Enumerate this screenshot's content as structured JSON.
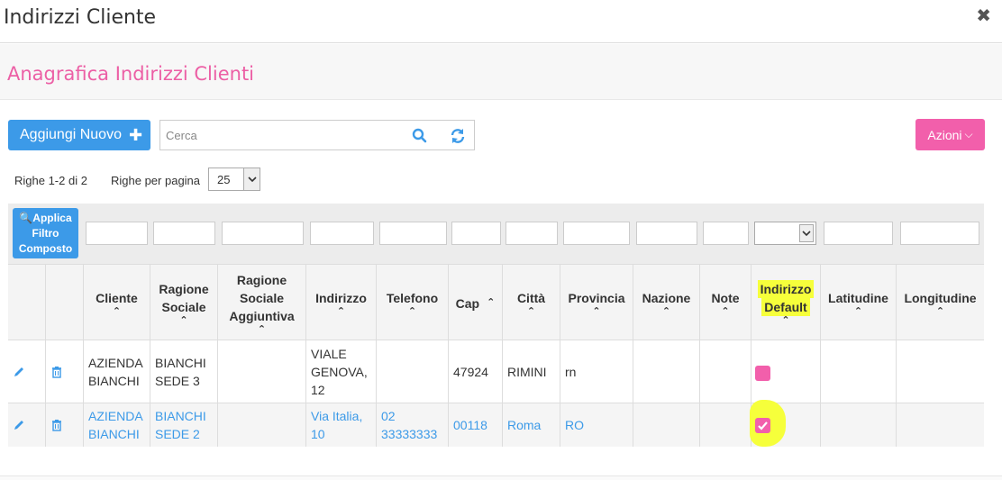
{
  "modal": {
    "title": "Indirizzi Cliente",
    "close_glyph": "✖"
  },
  "section": {
    "title": "Anagrafica Indirizzi Clienti"
  },
  "toolbar": {
    "add_label": "Aggiungi Nuovo",
    "add_glyph": "✚",
    "search_placeholder": "Cerca",
    "actions_label": "Azioni",
    "actions_glyph": "⌵"
  },
  "paging": {
    "rows_info": "Righe 1-2 di 2",
    "rows_per_page_label": "Righe per pagina",
    "rows_per_page_value": "25"
  },
  "filter": {
    "apply_label": "🔍Applica Filtro Composto"
  },
  "columns": [
    "",
    "",
    "Cliente",
    "Ragione Sociale",
    "Ragione Sociale Aggiuntiva",
    "Indirizzo",
    "Telefono",
    "Cap",
    "Città",
    "Provincia",
    "Nazione",
    "Note",
    "Indirizzo Default",
    "Latitudine",
    "Longitudine"
  ],
  "default_header_lines": [
    "Indirizzo",
    "Default"
  ],
  "rows": [
    {
      "cliente": "AZIENDA BIANCHI",
      "ragione_sociale": "BIANCHI SEDE 3",
      "ragione_sociale_agg": "",
      "indirizzo": "VIALE GENOVA, 12",
      "telefono": "",
      "cap": "47924",
      "citta": "RIMINI",
      "provincia": "rn",
      "nazione": "",
      "note": "",
      "default": false,
      "latitudine": "",
      "longitudine": ""
    },
    {
      "cliente": "AZIENDA BIANCHI",
      "ragione_sociale": "BIANCHI SEDE 2",
      "ragione_sociale_agg": "",
      "indirizzo": "Via Italia, 10",
      "telefono": "02 33333333",
      "cap": "00118",
      "citta": "Roma",
      "provincia": "RO",
      "nazione": "",
      "note": "",
      "default": true,
      "latitudine": "",
      "longitudine": ""
    }
  ],
  "colors": {
    "primary": "#3c9ae8",
    "accent": "#f25fab",
    "title_pink": "#ec5fa5",
    "highlight": "#f6ff3b"
  },
  "icons": {
    "edit": "pencil-icon",
    "delete": "trash-icon",
    "search": "search-icon",
    "refresh": "refresh-icon",
    "close": "close-icon"
  }
}
